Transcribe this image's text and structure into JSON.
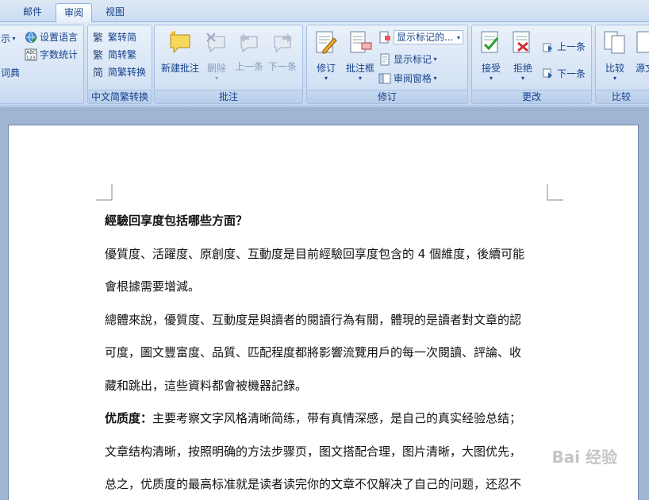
{
  "tabs": [
    {
      "label": "邮件",
      "active": false
    },
    {
      "label": "审阅",
      "active": true
    },
    {
      "label": "视图",
      "active": false
    }
  ],
  "ribbon": {
    "proofing": {
      "set_language": "设置语言",
      "word_count": "字数统计",
      "partial_1": "示",
      "partial_2": "词典"
    },
    "chinese_conversion": {
      "label": "中文简繁转换",
      "to_simplified": "繁转简",
      "to_traditional": "简转繁",
      "convert": "简繁转换"
    },
    "comments": {
      "label": "批注",
      "new": "新建批注",
      "delete": "删除",
      "prev": "上一条",
      "next": "下一条"
    },
    "tracking": {
      "label": "修订",
      "track": "修订",
      "balloons": "批注框",
      "display_select": "显示标记的...",
      "show_markup": "显示标记",
      "review_pane": "审阅窗格"
    },
    "changes": {
      "label": "更改",
      "accept": "接受",
      "reject": "拒绝",
      "prev": "上一条",
      "next": "下一条"
    },
    "compare": {
      "label": "比较",
      "compare": "比较",
      "source": "源文"
    }
  },
  "document": {
    "heading": "經驗回享度包括哪些方面？",
    "lines": [
      "優質度、活躍度、原創度、互動度是目前經驗回享度包含的 4 個維度，後續可能",
      "會根據需要增減。",
      "總體來說，優質度、互動度是與讀者的閱讀行為有關，體現的是讀者對文章的認",
      "可度，圖文豐富度、品質、匹配程度都將影響流覽用戶的每一次閱讀、評論、收",
      "藏和跳出，這些資料都會被機器記錄。"
    ],
    "quality_label": "优质度：",
    "quality_text": "主要考察文字风格清晰简练，带有真情深感，是自己的真实经验总结；",
    "line_7": "文章结构清晰，按照明确的方法步骤页，图文搭配合理，图片清晰，大图优先，",
    "line_8": "总之，优质度的最高标准就是读者读完你的文章不仅解决了自己的问题，还忍不"
  },
  "watermark": "Bai 经验",
  "colors": {
    "ribbon_text": "#15428b",
    "page_bg": "#ffffff",
    "doc_bg": "#a0b5d3"
  }
}
